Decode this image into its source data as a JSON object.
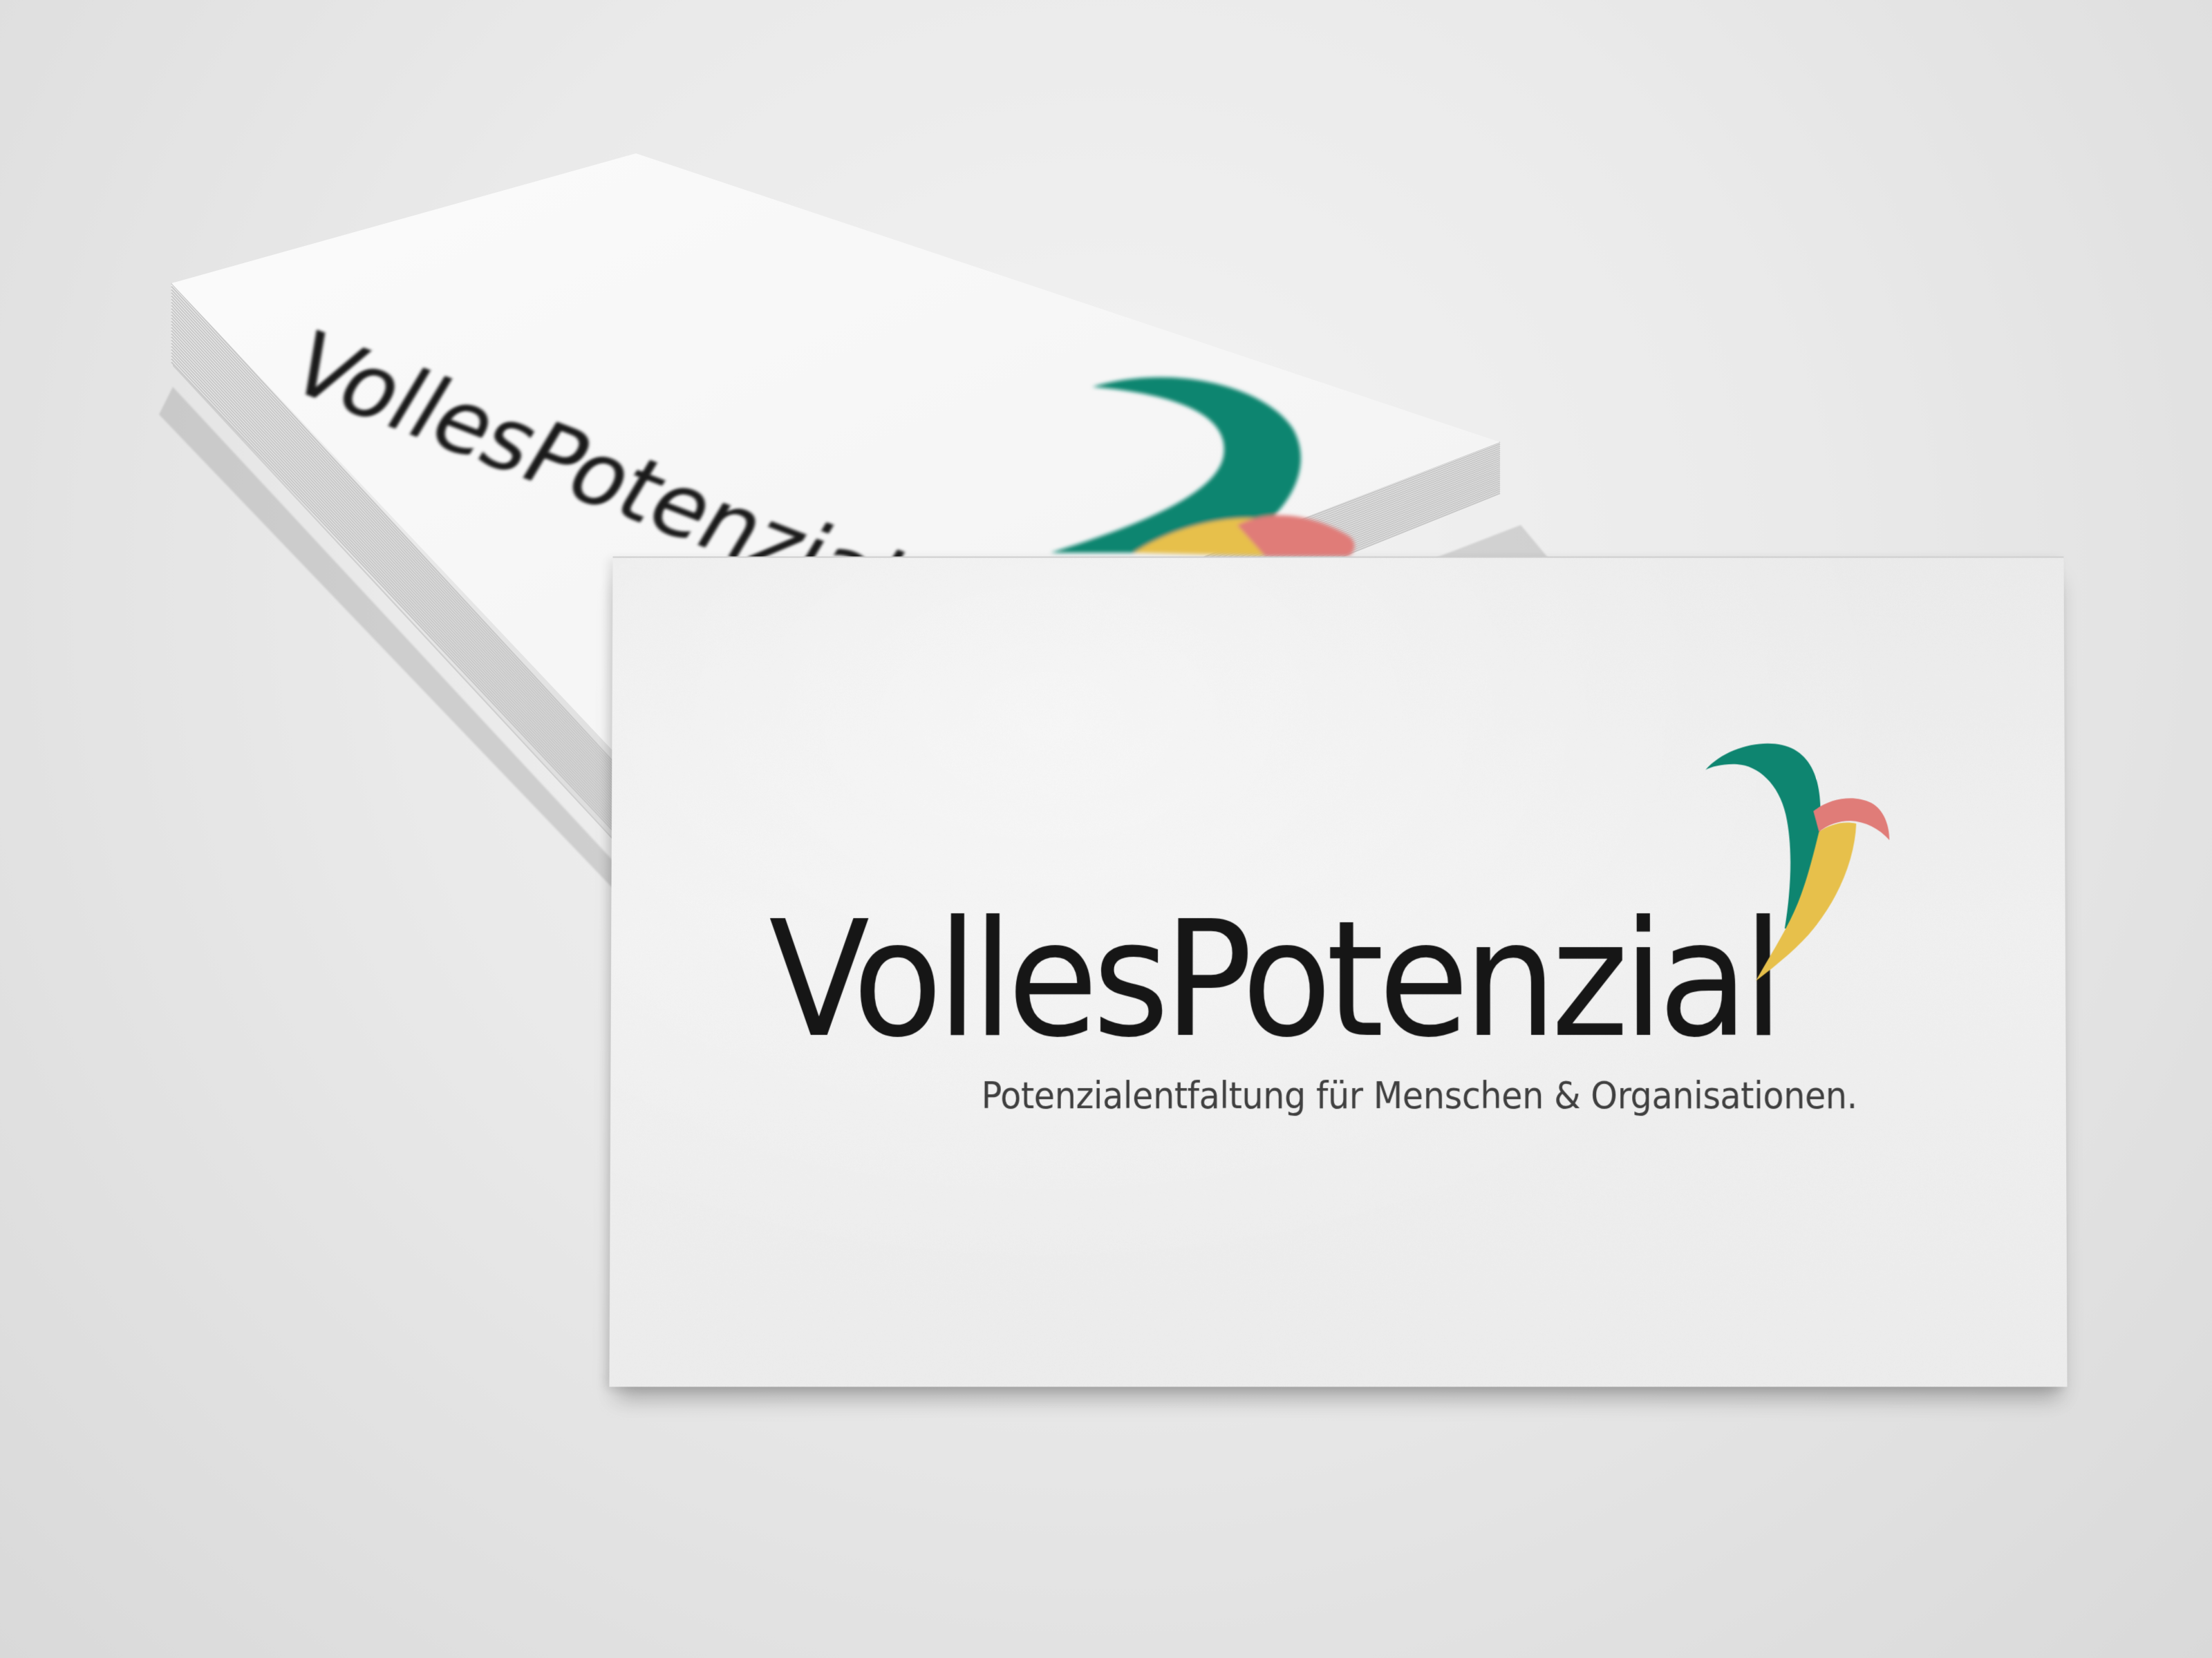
{
  "scene": {
    "background_color": "#e6e6e6",
    "card_color": "#efefef"
  },
  "back_stack": {
    "wordmark": "VollesPotenzial"
  },
  "front_card": {
    "wordmark": "VollesPotenzial",
    "tagline": "Potenzialentfaltung für Menschen & Organisationen."
  },
  "logo": {
    "icon": "three-swoosh-mark-icon",
    "colors": {
      "green": "#0e8570",
      "yellow": "#e7c04b",
      "coral": "#e07c78"
    }
  }
}
